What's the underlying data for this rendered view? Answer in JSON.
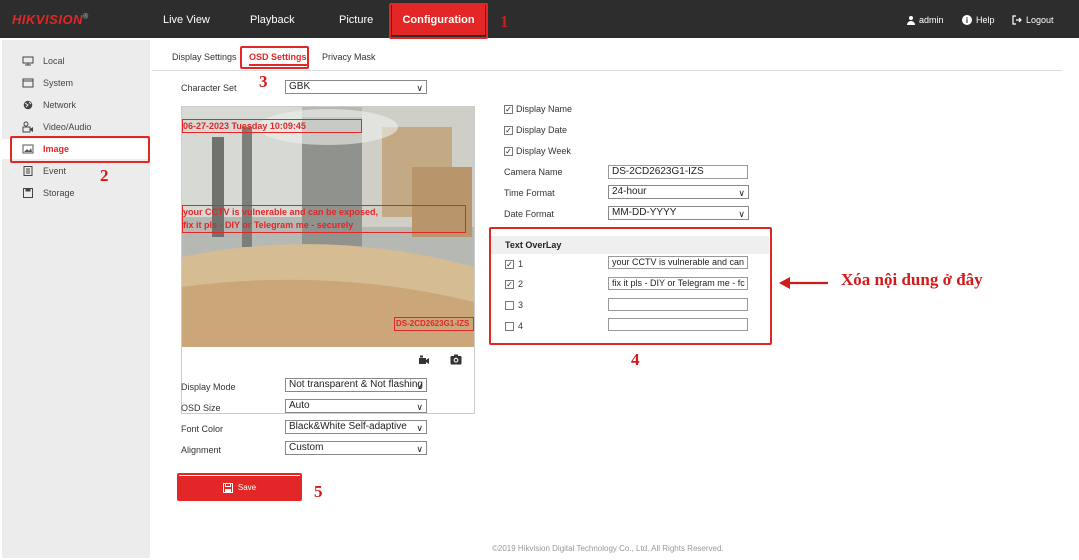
{
  "header": {
    "logo": "HIKVISION",
    "logo_mark": "®",
    "nav": [
      "Live View",
      "Playback",
      "Picture",
      "Configuration"
    ],
    "user": "admin",
    "help": "Help",
    "logout": "Logout"
  },
  "sidebar": {
    "items": [
      "Local",
      "System",
      "Network",
      "Video/Audio",
      "Image",
      "Event",
      "Storage"
    ]
  },
  "subtabs": [
    "Display Settings",
    "OSD Settings",
    "Privacy Mask"
  ],
  "osd": {
    "character_set_label": "Character Set",
    "character_set_value": "GBK",
    "display_name": "Display Name",
    "display_date": "Display Date",
    "display_week": "Display Week",
    "camera_name_label": "Camera Name",
    "camera_name_value": "DS-2CD2623G1-IZS",
    "time_format_label": "Time Format",
    "time_format_value": "24-hour",
    "date_format_label": "Date Format",
    "date_format_value": "MM-DD-YYYY",
    "text_overlay_title": "Text OverLay",
    "overlay_rows": [
      {
        "num": "1",
        "checked": true,
        "value": "your CCTV is vulnerable and can"
      },
      {
        "num": "2",
        "checked": true,
        "value": "fix it pls - DIY or Telegram me - fc"
      },
      {
        "num": "3",
        "checked": false,
        "value": ""
      },
      {
        "num": "4",
        "checked": false,
        "value": ""
      }
    ],
    "display_mode_label": "Display Mode",
    "display_mode_value": "Not transparent & Not flashing",
    "osd_size_label": "OSD Size",
    "osd_size_value": "Auto",
    "font_color_label": "Font Color",
    "font_color_value": "Black&White Self-adaptive",
    "alignment_label": "Alignment",
    "alignment_value": "Custom",
    "save_label": "Save"
  },
  "preview": {
    "osd_datetime": "06-27-2023 Tuesday 10:09:45",
    "osd_line1": "your CCTV is vulnerable and can be exposed,",
    "osd_line2": "fix it pls - DIY or Telegram me - securely",
    "osd_camera": "DS-2CD2623G1-IZS"
  },
  "annotations": {
    "n1": "1",
    "n2": "2",
    "n3": "3",
    "n4": "4",
    "n5": "5",
    "note": "Xóa nội dung ở đây"
  },
  "footer": "©2019 Hikvision Digital Technology Co., Ltd. All Rights Reserved.",
  "colors": {
    "accent": "#e32626",
    "topbar": "#2d2d2d",
    "sidebar": "#ececec"
  }
}
